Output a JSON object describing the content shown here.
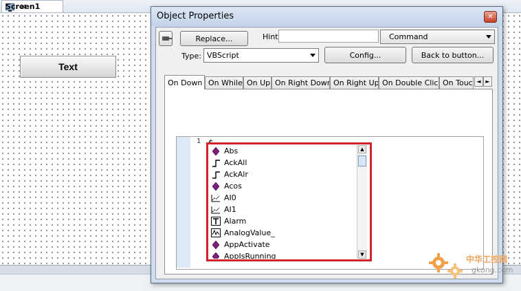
{
  "editor_tab": {
    "label": "Screen1",
    "close_glyph": "✕"
  },
  "canvas": {
    "text_widget_label": "Text"
  },
  "dialog": {
    "title": "Object Properties",
    "close_glyph": "✕",
    "replace_label": "Replace...",
    "hint_label": "Hint:",
    "hint_value": "",
    "command_value": "Command",
    "type_label": "Type:",
    "type_value": "VBScript",
    "config_label": "Config...",
    "back_label": "Back to button...",
    "tabs": [
      "On Down",
      "On While",
      "On Up",
      "On Right Down",
      "On Right Up",
      "On Double Click",
      "On Touc"
    ],
    "active_tab": "On Down",
    "tab_scroll_left": "◄",
    "tab_scroll_right": "►"
  },
  "code_editor": {
    "line_number": "1",
    "line_text": "$"
  },
  "autocomplete": {
    "items": [
      {
        "label": "Abs",
        "icon": "method-diamond-icon"
      },
      {
        "label": "AckAll",
        "icon": "step-signal-icon"
      },
      {
        "label": "AckAlr",
        "icon": "step-signal-icon"
      },
      {
        "label": "Acos",
        "icon": "method-diamond-icon"
      },
      {
        "label": "AI0",
        "icon": "trend-chart-icon"
      },
      {
        "label": "AI1",
        "icon": "trend-chart-icon"
      },
      {
        "label": "Alarm",
        "icon": "text-box-icon"
      },
      {
        "label": "AnalogValue_",
        "icon": "analog-value-icon"
      },
      {
        "label": "AppActivate",
        "icon": "method-diamond-icon"
      },
      {
        "label": "AppIsRunning",
        "icon": "method-diamond-icon"
      }
    ],
    "scroll_up": "▲",
    "scroll_down": "▼"
  },
  "colors": {
    "highlight_border": "#d2232a",
    "diamond": "#7a1f7a",
    "dialog_frame": "#cfdcec"
  },
  "watermark": {
    "text": "中华工控网",
    "domain": "gkong.com"
  }
}
